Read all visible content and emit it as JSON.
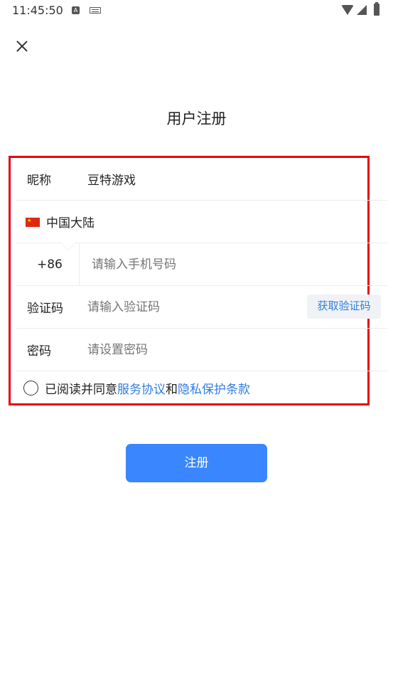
{
  "status_bar": {
    "time": "11:45:50",
    "notification_a": "A",
    "icons": [
      "text-icon",
      "keyboard-icon",
      "wifi-icon",
      "signal-icon",
      "battery-icon"
    ]
  },
  "header": {
    "close_icon": "close-icon",
    "title": "用户注册"
  },
  "form": {
    "nickname": {
      "label": "昵称",
      "value": "豆特游戏"
    },
    "region": {
      "flag_icon": "china-flag-icon",
      "value": "中国大陆"
    },
    "phone": {
      "prefix": "+86",
      "placeholder": "请输入手机号码"
    },
    "verification": {
      "label": "验证码",
      "placeholder": "请输入验证码",
      "button_label": "获取验证码"
    },
    "password": {
      "label": "密码",
      "placeholder": "请设置密码"
    }
  },
  "agreement": {
    "text_before": "已阅读并同意",
    "service_link": "服务协议",
    "conjunction": "和",
    "privacy_link": "隐私保护条款"
  },
  "submit_label": "注册",
  "colors": {
    "accent": "#3a86ff",
    "link": "#2f7de1",
    "highlight_border": "#e60012"
  }
}
